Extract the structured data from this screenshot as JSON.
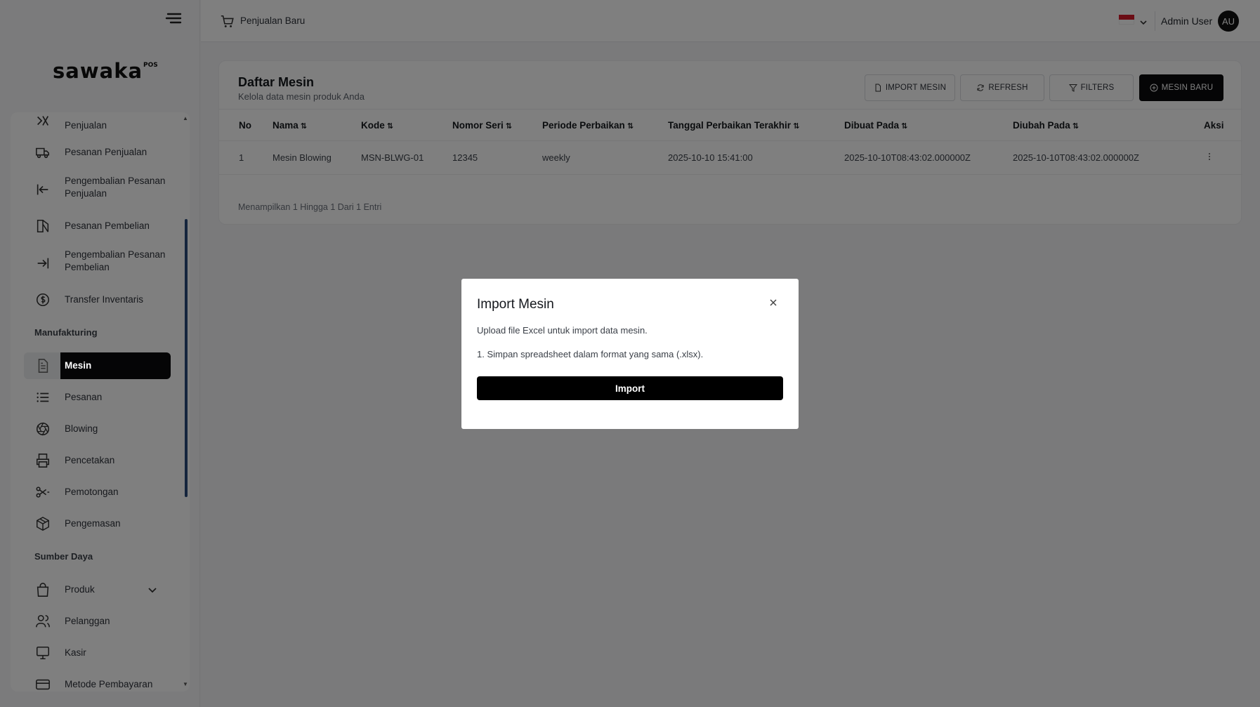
{
  "app": {
    "logo_text": "sawaka",
    "logo_sup": "POS"
  },
  "header": {
    "new_sale_label": "Penjualan Baru",
    "user_name": "Admin User",
    "user_initials": "AU"
  },
  "sidebar": {
    "items": [
      {
        "label": "Penjualan",
        "icon": "sales-icon"
      },
      {
        "label": "Pesanan Penjualan",
        "icon": "truck-icon"
      },
      {
        "label": "Pengembalian Pesanan Penjualan",
        "icon": "arrow-left-bar-icon"
      },
      {
        "label": "Pesanan Pembelian",
        "icon": "purchase-icon"
      },
      {
        "label": "Pengembalian Pesanan Pembelian",
        "icon": "arrow-right-bar-icon"
      },
      {
        "label": "Transfer Inventaris",
        "icon": "dollar-circle-icon"
      },
      {
        "label": "Mesin",
        "icon": "document-icon"
      },
      {
        "label": "Pesanan",
        "icon": "list-icon"
      },
      {
        "label": "Blowing",
        "icon": "aperture-icon"
      },
      {
        "label": "Pencetakan",
        "icon": "printer-icon"
      },
      {
        "label": "Pemotongan",
        "icon": "scissors-icon"
      },
      {
        "label": "Pengemasan",
        "icon": "package-icon"
      },
      {
        "label": "Produk",
        "icon": "bag-icon"
      },
      {
        "label": "Pelanggan",
        "icon": "users-icon"
      },
      {
        "label": "Kasir",
        "icon": "monitor-icon"
      },
      {
        "label": "Metode Pembayaran",
        "icon": "card-icon"
      }
    ],
    "sections": {
      "manufacturing": "Manufakturing",
      "resources": "Sumber Daya"
    },
    "active": "Mesin"
  },
  "page": {
    "title": "Daftar Mesin",
    "subtitle": "Kelola data mesin produk Anda",
    "buttons": {
      "import": "IMPORT MESIN",
      "refresh": "REFRESH",
      "filters": "FILTERS",
      "new": "MESIN BARU"
    },
    "footer": "Menampilkan 1 Hingga 1 Dari 1 Entri"
  },
  "table": {
    "columns": [
      "No",
      "Nama",
      "Kode",
      "Nomor Seri",
      "Periode Perbaikan",
      "Tanggal Perbaikan Terakhir",
      "Dibuat Pada",
      "Diubah Pada",
      "Aksi"
    ],
    "rows": [
      [
        "1",
        "Mesin Blowing",
        "MSN-BLWG-01",
        "12345",
        "weekly",
        "2025-10-10 15:41:00",
        "2025-10-10T08:43:02.000000Z",
        "2025-10-10T08:43:02.000000Z"
      ]
    ]
  },
  "modal": {
    "title": "Import Mesin",
    "description": "Upload file Excel untuk import data mesin.",
    "step1": "1. Simpan spreadsheet dalam format yang sama (.xlsx).",
    "button": "Import"
  },
  "colors": {
    "primary": "#0b0b0d",
    "flag_red": "#d71b2b",
    "scrollbar": "#2a4a7a"
  }
}
